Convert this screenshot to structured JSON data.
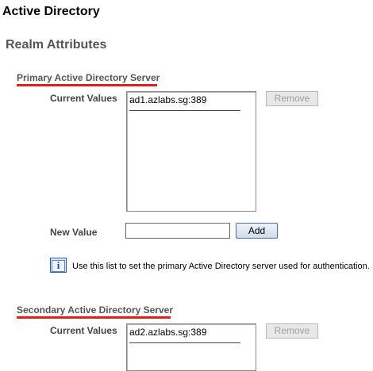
{
  "page_title": "Active Directory",
  "realm_title": "Realm Attributes",
  "primary": {
    "section_title": "Primary Active Directory Server",
    "current_values_label": "Current Values",
    "values": [
      "ad1.azlabs.sg:389"
    ],
    "remove_label": "Remove",
    "new_value_label": "New Value",
    "new_value": "",
    "add_label": "Add",
    "info_icon": "i",
    "help_text": "Use this list to set the primary Active Directory server used for authentication."
  },
  "secondary": {
    "section_title": "Secondary Active Directory Server",
    "current_values_label": "Current Values",
    "values": [
      "ad2.azlabs.sg:389"
    ],
    "remove_label": "Remove"
  },
  "colors": {
    "underline": "#e0201c",
    "section_text": "#555555"
  }
}
